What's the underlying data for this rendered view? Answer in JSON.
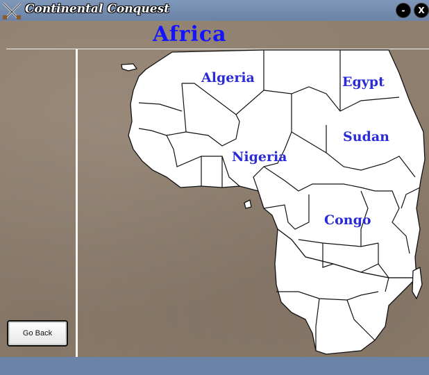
{
  "window": {
    "title": "Continental Conquest",
    "minimize_label": "-",
    "close_label": "X"
  },
  "header": {
    "title": "Africa"
  },
  "map": {
    "labels": {
      "algeria": "Algeria",
      "egypt": "Egypt",
      "sudan": "Sudan",
      "nigeria": "Nigeria",
      "congo": "Congo"
    }
  },
  "buttons": {
    "go_back_label": "Go Back"
  },
  "colors": {
    "titlebar": "#6a83a6",
    "parchment": "#8f7f6e",
    "label": "#2a2ad6",
    "heading": "#1414ff"
  }
}
